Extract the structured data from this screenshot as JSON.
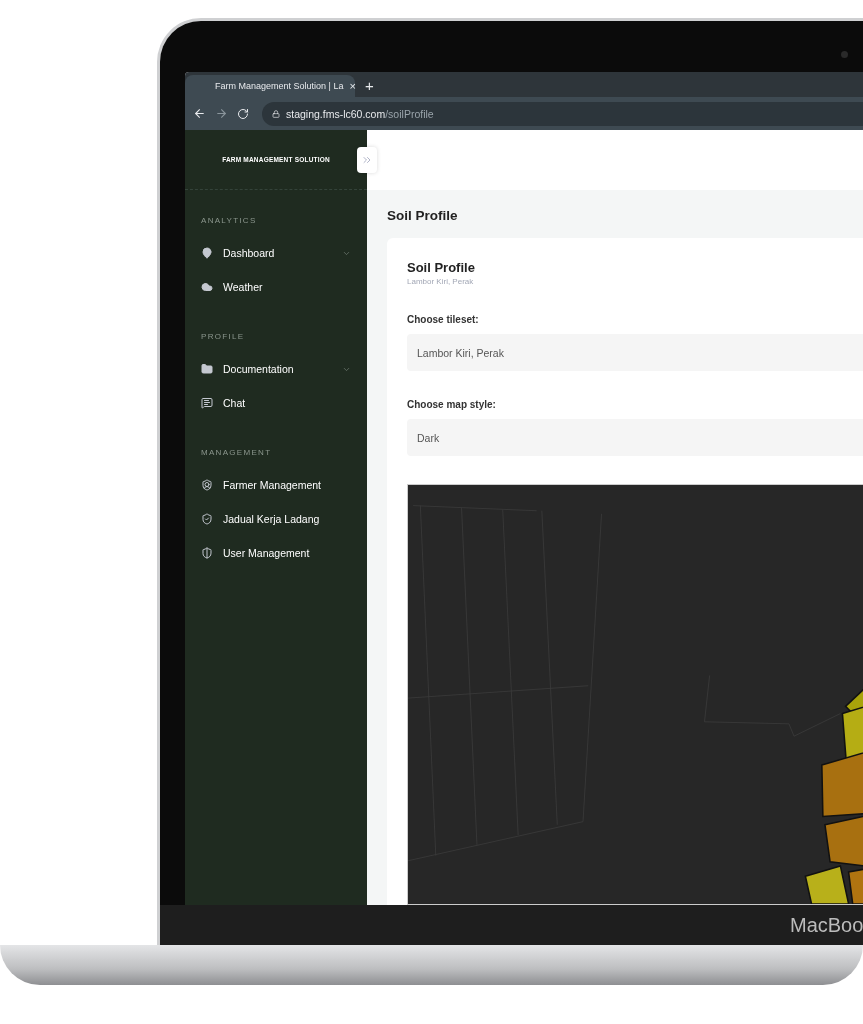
{
  "browser": {
    "tab_title": "Farm Management Solution | La",
    "tab_close": "×",
    "new_tab": "+",
    "forward_enabled": false,
    "url_host": "staging.fms-lc60.com",
    "url_path": "/soilProfile"
  },
  "sidebar": {
    "brand": "FARM MANAGEMENT SOLUTION",
    "sections": [
      {
        "heading": "ANALYTICS",
        "items": [
          {
            "label": "Dashboard",
            "has_submenu": true
          },
          {
            "label": "Weather",
            "has_submenu": false
          }
        ]
      },
      {
        "heading": "PROFILE",
        "items": [
          {
            "label": "Documentation",
            "has_submenu": true
          },
          {
            "label": "Chat",
            "has_submenu": false
          }
        ]
      },
      {
        "heading": "MANAGEMENT",
        "items": [
          {
            "label": "Farmer Management",
            "has_submenu": false
          },
          {
            "label": "Jadual Kerja Ladang",
            "has_submenu": false
          },
          {
            "label": "User Management",
            "has_submenu": false
          }
        ]
      }
    ]
  },
  "page_title": "Soil Profile",
  "card": {
    "title": "Soil Profile",
    "subtitle": "Lambor Kiri, Perak",
    "fields": [
      {
        "label": "Choose tileset:",
        "value": "Lambor Kiri, Perak"
      },
      {
        "label": "Choose map style:",
        "value": "Dark"
      }
    ]
  },
  "laptop_label": "MacBoo"
}
